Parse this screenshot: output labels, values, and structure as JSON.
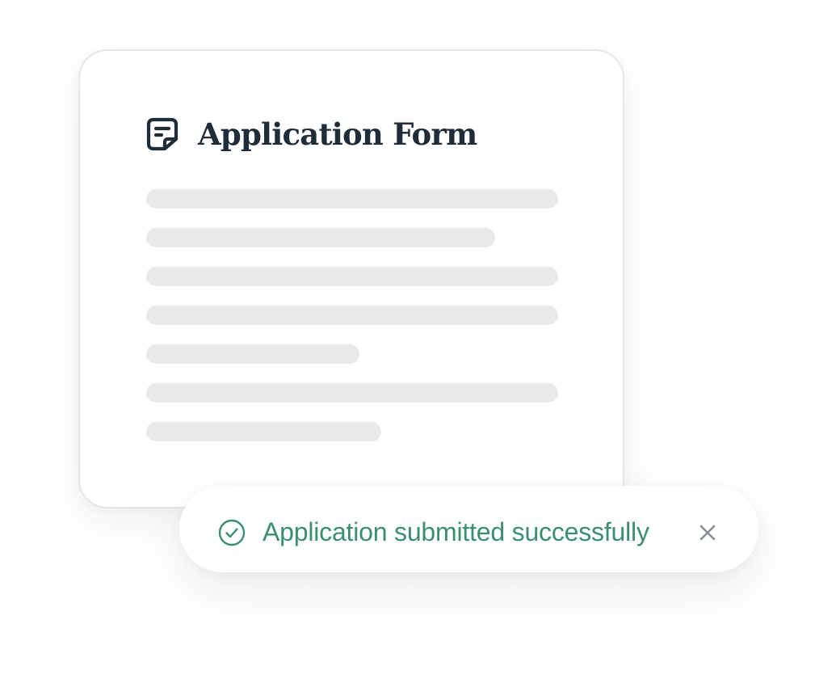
{
  "form": {
    "title": "Application Form",
    "icon": "form-document-icon",
    "skeleton_lines": [
      {
        "fill": 1.0
      },
      {
        "fill": 0.847
      },
      {
        "fill": 1.0
      },
      {
        "fill": 1.0
      },
      {
        "fill": 0.518
      },
      {
        "fill": 1.0
      },
      {
        "fill": 0.571
      }
    ]
  },
  "toast": {
    "message": "Application submitted successfully",
    "status_icon": "check-circle-icon",
    "close_icon": "close-icon"
  },
  "colors": {
    "title": "#1f2d3a",
    "skeleton": "#e8e9eb",
    "success": "#3a8f6c",
    "close": "#8a9096",
    "card_border": "#e6e6e8"
  }
}
